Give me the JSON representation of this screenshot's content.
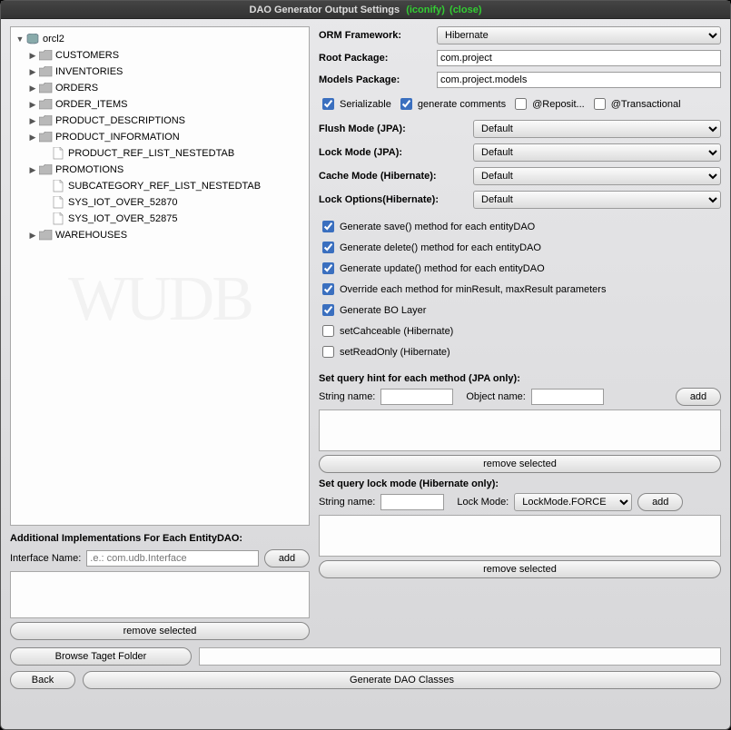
{
  "title": "DAO Generator Output Settings",
  "title_iconify": "(iconify)",
  "title_close": "(close)",
  "tree": {
    "root": "orcl2",
    "children": [
      {
        "label": "CUSTOMERS",
        "type": "folder",
        "exp": true
      },
      {
        "label": "INVENTORIES",
        "type": "folder",
        "exp": true
      },
      {
        "label": "ORDERS",
        "type": "folder",
        "exp": true
      },
      {
        "label": "ORDER_ITEMS",
        "type": "folder",
        "exp": true
      },
      {
        "label": "PRODUCT_DESCRIPTIONS",
        "type": "folder",
        "exp": true
      },
      {
        "label": "PRODUCT_INFORMATION",
        "type": "folder",
        "exp": true
      },
      {
        "label": "PRODUCT_REF_LIST_NESTEDTAB",
        "type": "file",
        "exp": false,
        "indent": 2
      },
      {
        "label": "PROMOTIONS",
        "type": "folder",
        "exp": true
      },
      {
        "label": "SUBCATEGORY_REF_LIST_NESTEDTAB",
        "type": "file",
        "exp": false,
        "indent": 2
      },
      {
        "label": "SYS_IOT_OVER_52870",
        "type": "file",
        "exp": false,
        "indent": 2
      },
      {
        "label": "SYS_IOT_OVER_52875",
        "type": "file",
        "exp": false,
        "indent": 2
      },
      {
        "label": "WAREHOUSES",
        "type": "folder",
        "exp": true
      }
    ]
  },
  "form": {
    "orm_label": "ORM Framework:",
    "orm_value": "Hibernate",
    "rootpkg_label": "Root Package:",
    "rootpkg_value": "com.project",
    "modelspkg_label": "Models Package:",
    "modelspkg_value": "com.project.models",
    "cb_serializable": "Serializable",
    "cb_gencomments": "generate comments",
    "cb_repository": "@Reposit...",
    "cb_transactional": "@Transactional",
    "flush_label": "Flush Mode (JPA):",
    "flush_value": "Default",
    "lockjpa_label": "Lock Mode (JPA):",
    "lockjpa_value": "Default",
    "cache_label": "Cache Mode (Hibernate):",
    "cache_value": "Default",
    "lockhib_label": "Lock Options(Hibernate):",
    "lockhib_value": "Default",
    "opts": [
      {
        "label": "Generate save() method for each entityDAO",
        "checked": true
      },
      {
        "label": "Generate delete() method for each entityDAO",
        "checked": true
      },
      {
        "label": "Generate update() method for each entityDAO",
        "checked": true
      },
      {
        "label": "Override each method for minResult, maxResult parameters",
        "checked": true
      },
      {
        "label": "Generate BO Layer",
        "checked": true
      },
      {
        "label": "setCahceable (Hibernate)",
        "checked": false
      },
      {
        "label": "setReadOnly (Hibernate)",
        "checked": false
      }
    ],
    "queryhint_heading": "Set query hint for each method (JPA only):",
    "stringname_label": "String name:",
    "objectname_label": "Object name:",
    "add_btn": "add",
    "remove_btn": "remove selected",
    "querylock_heading": "Set query lock mode (Hibernate only):",
    "lockmode_label": "Lock Mode:",
    "lockmode_value": "LockMode.FORCE"
  },
  "left_addl": {
    "heading": "Additional Implementations For Each EntityDAO:",
    "iface_label": "Interface Name:",
    "iface_placeholder": ".e.: com.udb.Interface",
    "add_btn": "add",
    "remove_btn": "remove selected"
  },
  "bottom": {
    "browse": "Browse Taget Folder",
    "back": "Back",
    "generate": "Generate DAO Classes"
  }
}
